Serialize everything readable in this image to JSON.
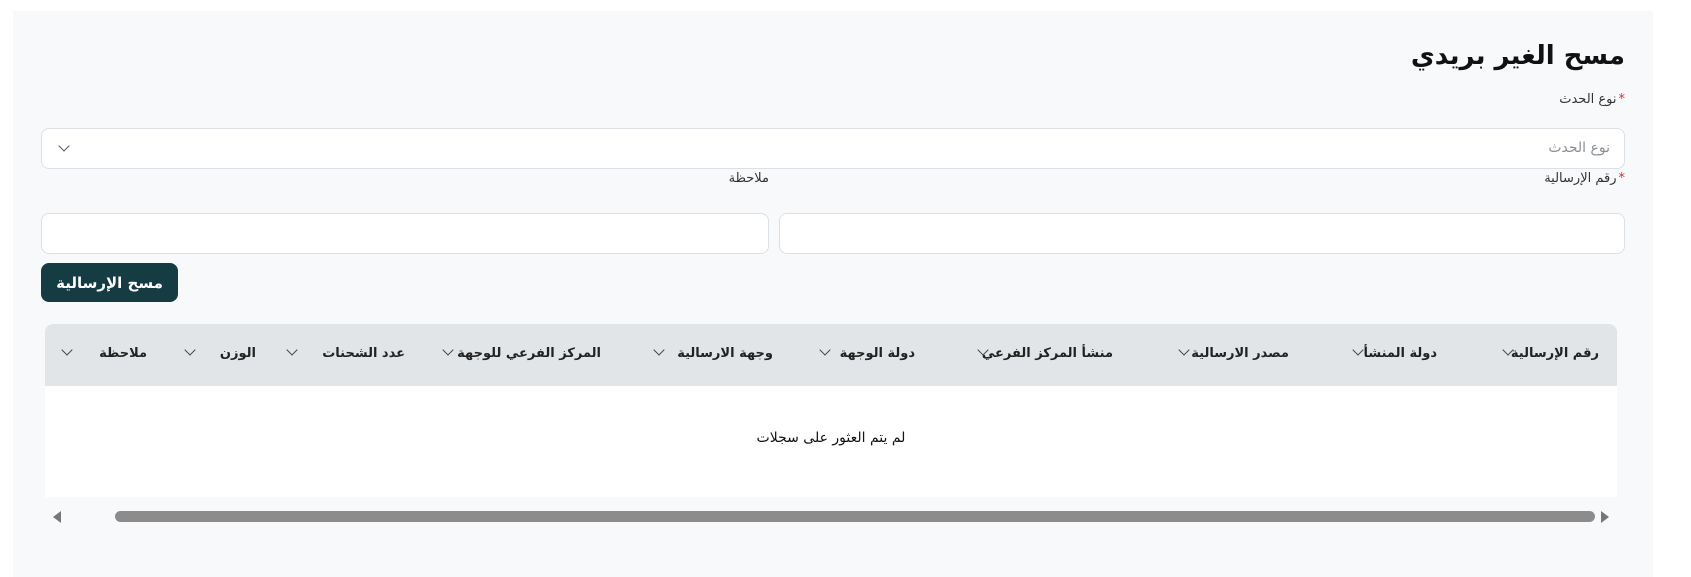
{
  "page": {
    "title": "مسح الغير بريدي"
  },
  "form": {
    "event_type": {
      "label": "نوع الحدث",
      "required_mark": "*",
      "placeholder": "نوع الحدث"
    },
    "shipment_number": {
      "label": "رقم الإرسالية",
      "required_mark": "*",
      "value": ""
    },
    "note": {
      "label": "ملاحظة",
      "value": ""
    },
    "submit_label": "مسح الإرسالية"
  },
  "table": {
    "columns": [
      "رقم الإرسالية",
      "دولة المنشأ",
      "مصدر الارسالية",
      "منشأ المركز الفرعي",
      "دولة الوجهة",
      "وجهة الارسالية",
      "المركز الفرعي للوجهة",
      "عدد الشحنات",
      "الوزن",
      "ملاحظة"
    ],
    "empty_message": "لم يتم العثور على سجلات"
  },
  "colors": {
    "primary_button": "#163c43",
    "required": "#d32f2f",
    "header_bg": "#e2e5e7",
    "panel_bg": "#f8f9fa"
  },
  "icons": {
    "select_chevron": "chevron-down-icon",
    "column_sort": "chevron-down-icon",
    "scroll_left": "triangle-left-icon",
    "scroll_right": "triangle-right-icon"
  }
}
